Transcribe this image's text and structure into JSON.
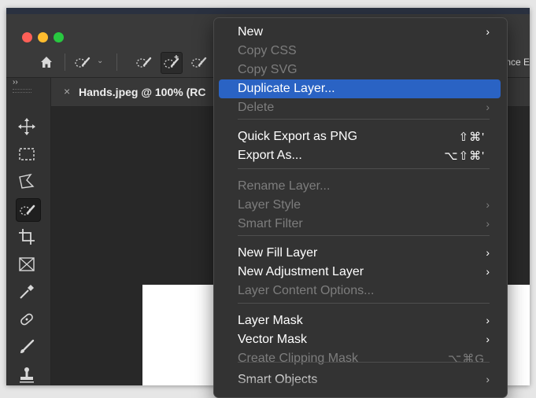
{
  "document_tab": {
    "close_glyph": "×",
    "title": "Hands.jpeg @ 100% (RC"
  },
  "options_bar": {
    "right_text": "nce E"
  },
  "toolbar": {
    "collapse_glyph": "››",
    "tools": [
      "move-tool",
      "marquee-tool",
      "lasso-tool",
      "quick-selection-tool",
      "crop-tool",
      "frame-tool",
      "eyedropper-tool",
      "spot-healing-brush-tool",
      "brush-tool",
      "clone-stamp-tool"
    ],
    "selected": "quick-selection-tool"
  },
  "menu": {
    "items": [
      {
        "label": "New",
        "submenu": true,
        "enabled": true
      },
      {
        "label": "Copy CSS",
        "enabled": false
      },
      {
        "label": "Copy SVG",
        "enabled": false
      },
      {
        "label": "Duplicate Layer...",
        "enabled": true,
        "highlighted": true
      },
      {
        "label": "Delete",
        "submenu": true,
        "enabled": false
      },
      {
        "label": "Quick Export as PNG",
        "shortcut": "⇧⌘'",
        "enabled": true
      },
      {
        "label": "Export As...",
        "shortcut": "⌥⇧⌘'",
        "enabled": true
      },
      {
        "label": "Rename Layer...",
        "enabled": false
      },
      {
        "label": "Layer Style",
        "submenu": true,
        "enabled": false
      },
      {
        "label": "Smart Filter",
        "submenu": true,
        "enabled": false
      },
      {
        "label": "New Fill Layer",
        "submenu": true,
        "enabled": true
      },
      {
        "label": "New Adjustment Layer",
        "submenu": true,
        "enabled": true
      },
      {
        "label": "Layer Content Options...",
        "enabled": false
      },
      {
        "label": "Layer Mask",
        "submenu": true,
        "enabled": true
      },
      {
        "label": "Vector Mask",
        "submenu": true,
        "enabled": true
      },
      {
        "label": "Create Clipping Mask",
        "shortcut": "⌥⌘G",
        "enabled": false
      },
      {
        "label": "Smart Objects",
        "submenu": true,
        "enabled": true
      }
    ],
    "submenu_glyph": "›"
  },
  "colors": {
    "highlight": "#2a63c4",
    "menu_bg": "#333333",
    "canvas": "#282828",
    "window_bg": "#323232"
  }
}
